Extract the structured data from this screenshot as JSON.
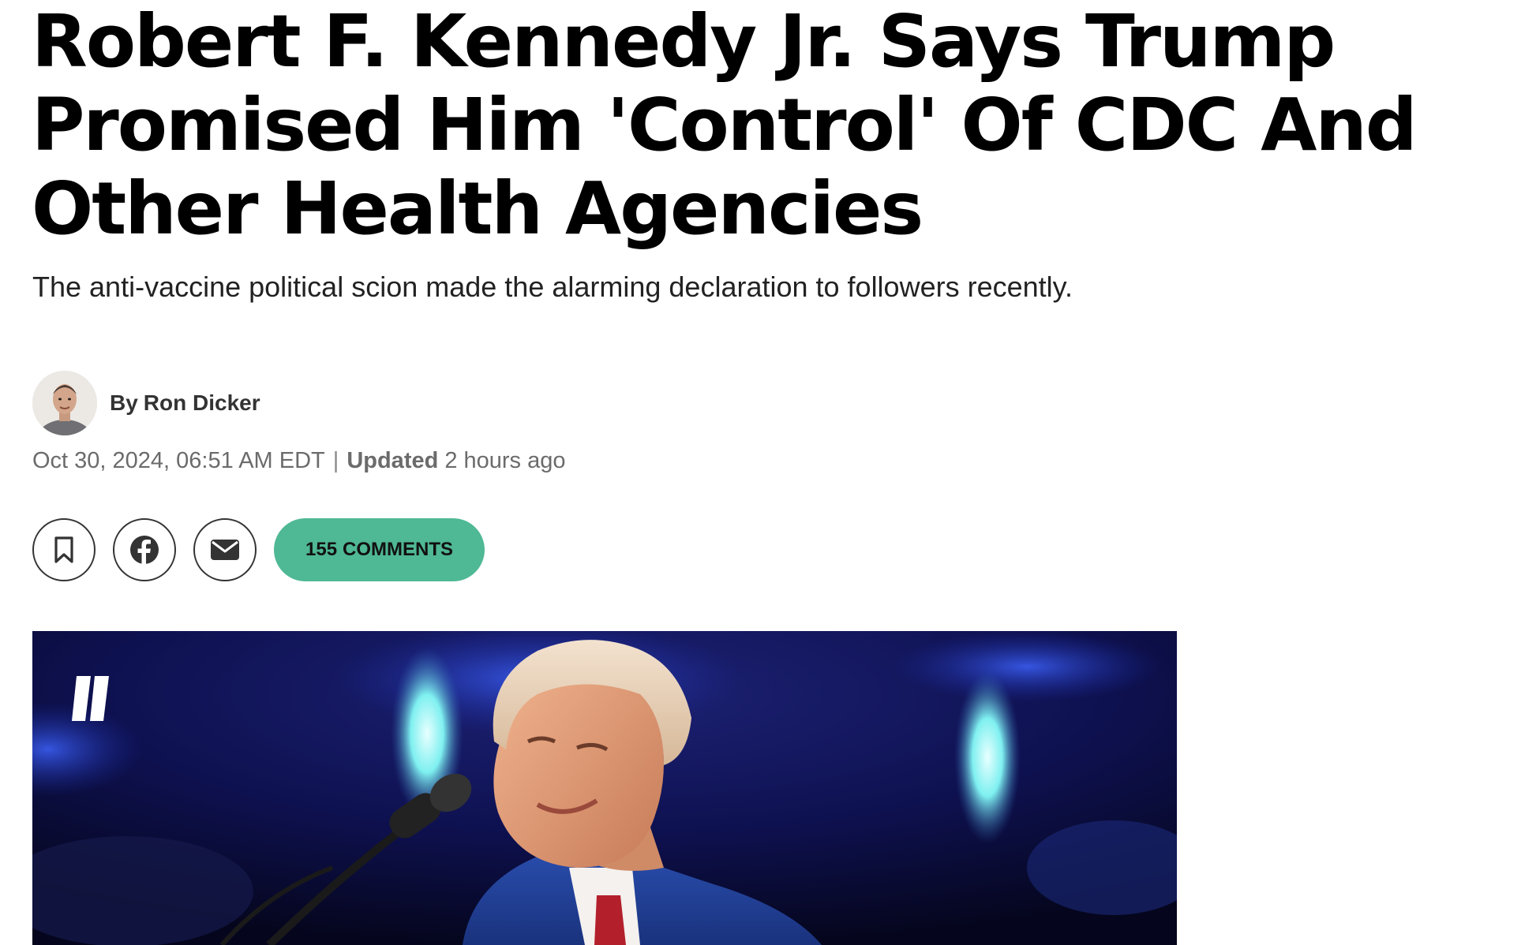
{
  "article": {
    "headline": "Robert F. Kennedy Jr. Says Trump Promised Him 'Control' Of CDC And Other Health Agencies",
    "subheadline": "The anti-vaccine political scion made the alarming declaration to followers recently.",
    "byline": {
      "prefix": "By",
      "author": "Ron Dicker"
    },
    "dateline": {
      "published": "Oct 30, 2024, 06:51 AM EDT",
      "separator": "|",
      "updated_label": "Updated",
      "updated_value": "2 hours ago"
    }
  },
  "actions": {
    "bookmark_icon": "bookmark-icon",
    "facebook_icon": "facebook-icon",
    "email_icon": "email-icon",
    "comments": {
      "count": "155",
      "label": "COMMENTS",
      "color": "#4fb894"
    }
  },
  "hero_image": {
    "watermark_icon": "huffpost-logo"
  }
}
